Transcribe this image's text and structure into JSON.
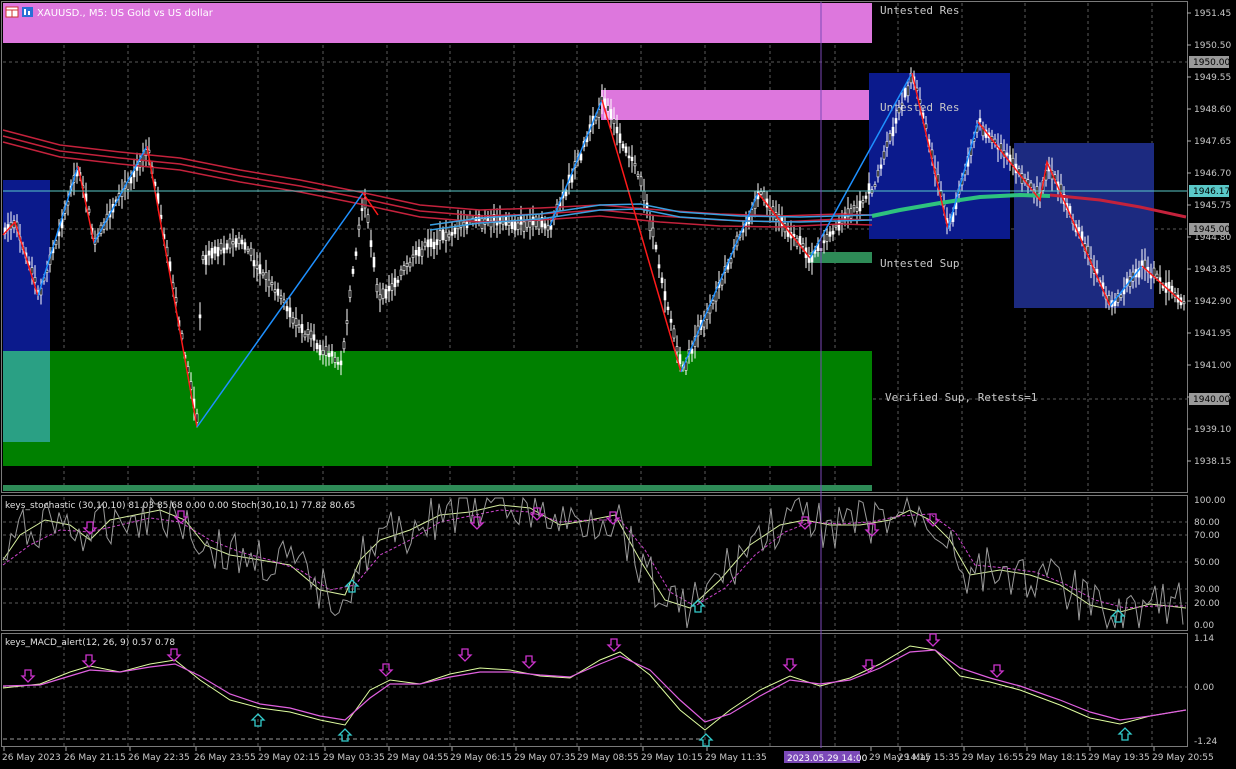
{
  "window": {
    "title": "XAUUSD., M5:  US Gold vs US dollar"
  },
  "colors": {
    "background": "#000000",
    "grid": "#6b6b6b",
    "axis_text": "#c8c8c8",
    "supply_zone": "#dd77dd",
    "demand_zone": "#008000",
    "navy_box": "#0b1a8c",
    "navy_box_light": "#1c2a80",
    "zigzag_up": "#1e90ff",
    "zigzag_down": "#ff1a1a",
    "ma_red": "#c4223c",
    "ma_blue": "#3aa0e0",
    "ma_green": "#2ec27e",
    "price_line": "#5ac8c8",
    "vline": "#7b49b8",
    "arrow_down": "#cc33cc",
    "arrow_up": "#33cccc"
  },
  "main_chart": {
    "zones": [
      {
        "label": "Untested Res"
      },
      {
        "label": "Untested Res"
      },
      {
        "label": "Untested Sup"
      },
      {
        "label": "Verified Sup, Retests=1"
      }
    ],
    "price_axis": {
      "ticks": [
        "1951.45",
        "1950.50",
        "1949.55",
        "1948.60",
        "1947.65",
        "1946.70",
        "1945.75",
        "1944.80",
        "1943.85",
        "1942.90",
        "1941.95",
        "1941.00",
        "1940.05",
        "1939.10",
        "1938.15"
      ],
      "markers": [
        {
          "label": "1950.00",
          "kind": "level"
        },
        {
          "label": "1946.17",
          "kind": "bid"
        },
        {
          "label": "1945.00",
          "kind": "level"
        },
        {
          "label": "1940.00",
          "kind": "level"
        }
      ]
    }
  },
  "stochastic": {
    "label": "keys_stochastic (30,10,10) 81.03 85.68 0.00 0.00 Stoch(30,10,1) 77.82 80.65",
    "ticks": [
      "100.00",
      "80.00",
      "70.00",
      "50.00",
      "30.00",
      "20.00",
      "0.00"
    ]
  },
  "macd": {
    "label": "keys_MACD_alert(12, 26, 9) 0.57 0.78",
    "ticks": [
      "1.14",
      "0.00",
      "-1.24"
    ]
  },
  "time_axis": {
    "labels": [
      "26 May 2023",
      "26 May 21:15",
      "26 May 22:35",
      "26 May 23:55",
      "29 May 02:15",
      "29 May 03:35",
      "29 May 04:55",
      "29 May 06:15",
      "29 May 07:35",
      "29 May 08:55",
      "29 May 10:15",
      "29 May 11:35",
      "29 May 14:15",
      "29 May 15:35",
      "29 May 16:55",
      "29 May 18:15",
      "29 May 19:35",
      "29 May 20:55"
    ],
    "cursor_label": "2023.05.29 14:00"
  },
  "icons": [
    "chart-window-icon",
    "chart-menu-icon"
  ]
}
